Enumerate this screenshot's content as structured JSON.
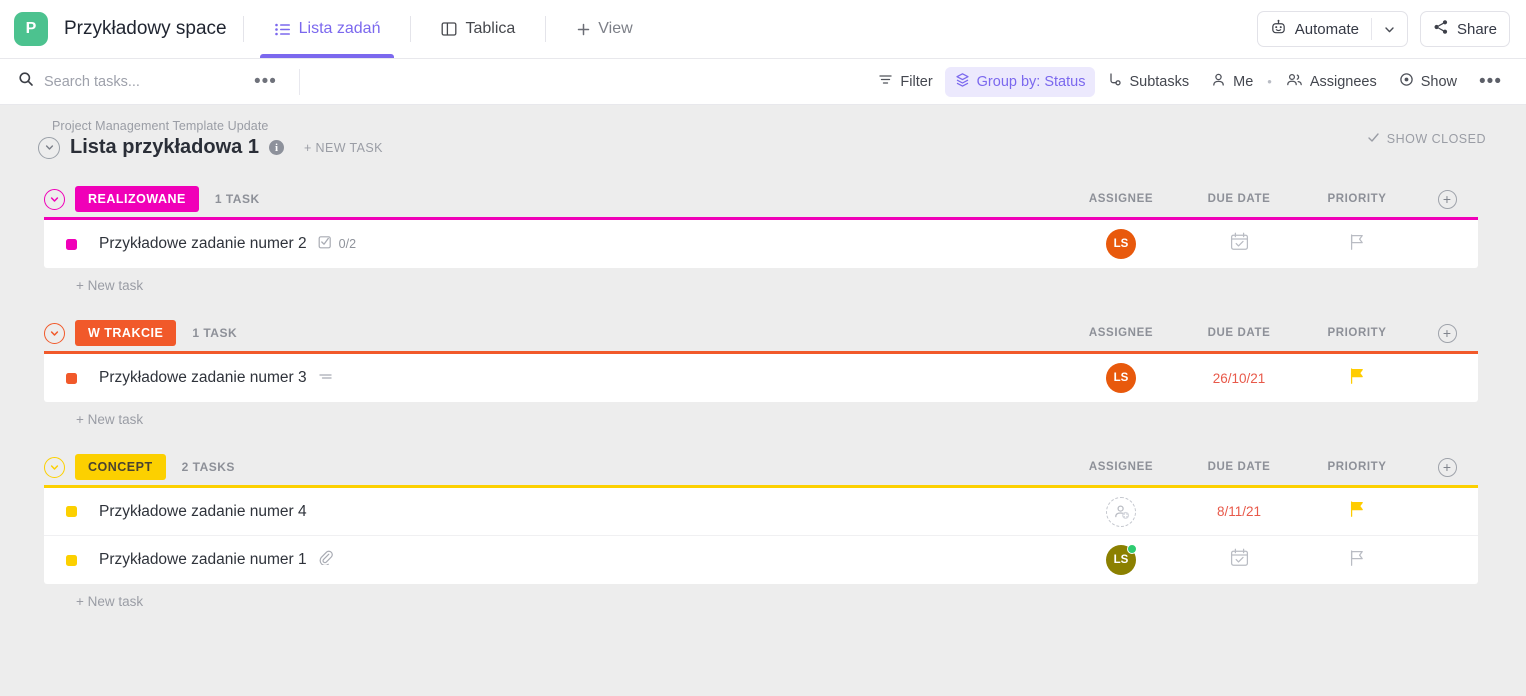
{
  "header": {
    "logo_letter": "P",
    "logo_color": "#4cc28f",
    "space_name": "Przykładowy space",
    "tabs": [
      {
        "label": "Lista zadań",
        "icon": "list-icon",
        "active": true
      },
      {
        "label": "Tablica",
        "icon": "board-icon",
        "active": false
      },
      {
        "label": "View",
        "icon": "plus-icon",
        "active": false
      }
    ],
    "automate_label": "Automate",
    "share_label": "Share",
    "accent_color": "#7b68ee"
  },
  "toolbar": {
    "search_placeholder": "Search tasks...",
    "search_value": "",
    "items": [
      {
        "label": "Filter",
        "icon": "filter-icon",
        "active": false
      },
      {
        "label": "Group by: Status",
        "icon": "layers-icon",
        "active": true
      },
      {
        "label": "Subtasks",
        "icon": "subtasks-icon",
        "active": false
      },
      {
        "label": "Me",
        "icon": "person-icon",
        "active": false
      },
      {
        "label": "Assignees",
        "icon": "people-icon",
        "active": false
      },
      {
        "label": "Show",
        "icon": "eye-icon",
        "active": false
      }
    ]
  },
  "list": {
    "breadcrumb": "Project Management Template Update",
    "title": "Lista przykładowa 1",
    "new_task_label": "+ NEW TASK",
    "show_closed_label": "SHOW CLOSED"
  },
  "columns": {
    "assignee": "ASSIGNEE",
    "due_date": "DUE DATE",
    "priority": "PRIORITY"
  },
  "new_task_label": "+ New task",
  "groups": [
    {
      "status": "REALIZOWANE",
      "color": "#f000b8",
      "text_color": "#ffffff",
      "count_label": "1 TASK",
      "tasks": [
        {
          "name": "Przykładowe zadanie numer 2",
          "dot_color": "#f000b8",
          "subtask_icon": "checklist-icon",
          "subtask_count": "0/2",
          "description_icon": false,
          "attachment_icon": false,
          "assignee": {
            "initials": "LS",
            "color": "#e8590c",
            "online": false,
            "empty": false
          },
          "due_date": "",
          "due_color": "",
          "priority": "none"
        }
      ]
    },
    {
      "status": "W TRAKCIE",
      "color": "#f1592a",
      "text_color": "#ffffff",
      "count_label": "1 TASK",
      "tasks": [
        {
          "name": "Przykładowe zadanie numer 3",
          "dot_color": "#f1592a",
          "subtask_icon": "",
          "subtask_count": "",
          "description_icon": true,
          "attachment_icon": false,
          "assignee": {
            "initials": "LS",
            "color": "#e8590c",
            "online": false,
            "empty": false
          },
          "due_date": "26/10/21",
          "due_color": "#e8594a",
          "priority": "high"
        }
      ]
    },
    {
      "status": "CONCEPT",
      "color": "#fcd000",
      "text_color": "#4a4330",
      "count_label": "2 TASKS",
      "tasks": [
        {
          "name": "Przykładowe zadanie numer 4",
          "dot_color": "#fcd000",
          "subtask_icon": "",
          "subtask_count": "",
          "description_icon": false,
          "attachment_icon": false,
          "assignee": {
            "initials": "",
            "color": "",
            "online": false,
            "empty": true
          },
          "due_date": "8/11/21",
          "due_color": "#e8594a",
          "priority": "high"
        },
        {
          "name": "Przykładowe zadanie numer 1",
          "dot_color": "#fcd000",
          "subtask_icon": "",
          "subtask_count": "",
          "description_icon": false,
          "attachment_icon": true,
          "assignee": {
            "initials": "LS",
            "color": "#8b8000",
            "online": true,
            "empty": false
          },
          "due_date": "",
          "due_color": "",
          "priority": "none"
        }
      ]
    }
  ]
}
